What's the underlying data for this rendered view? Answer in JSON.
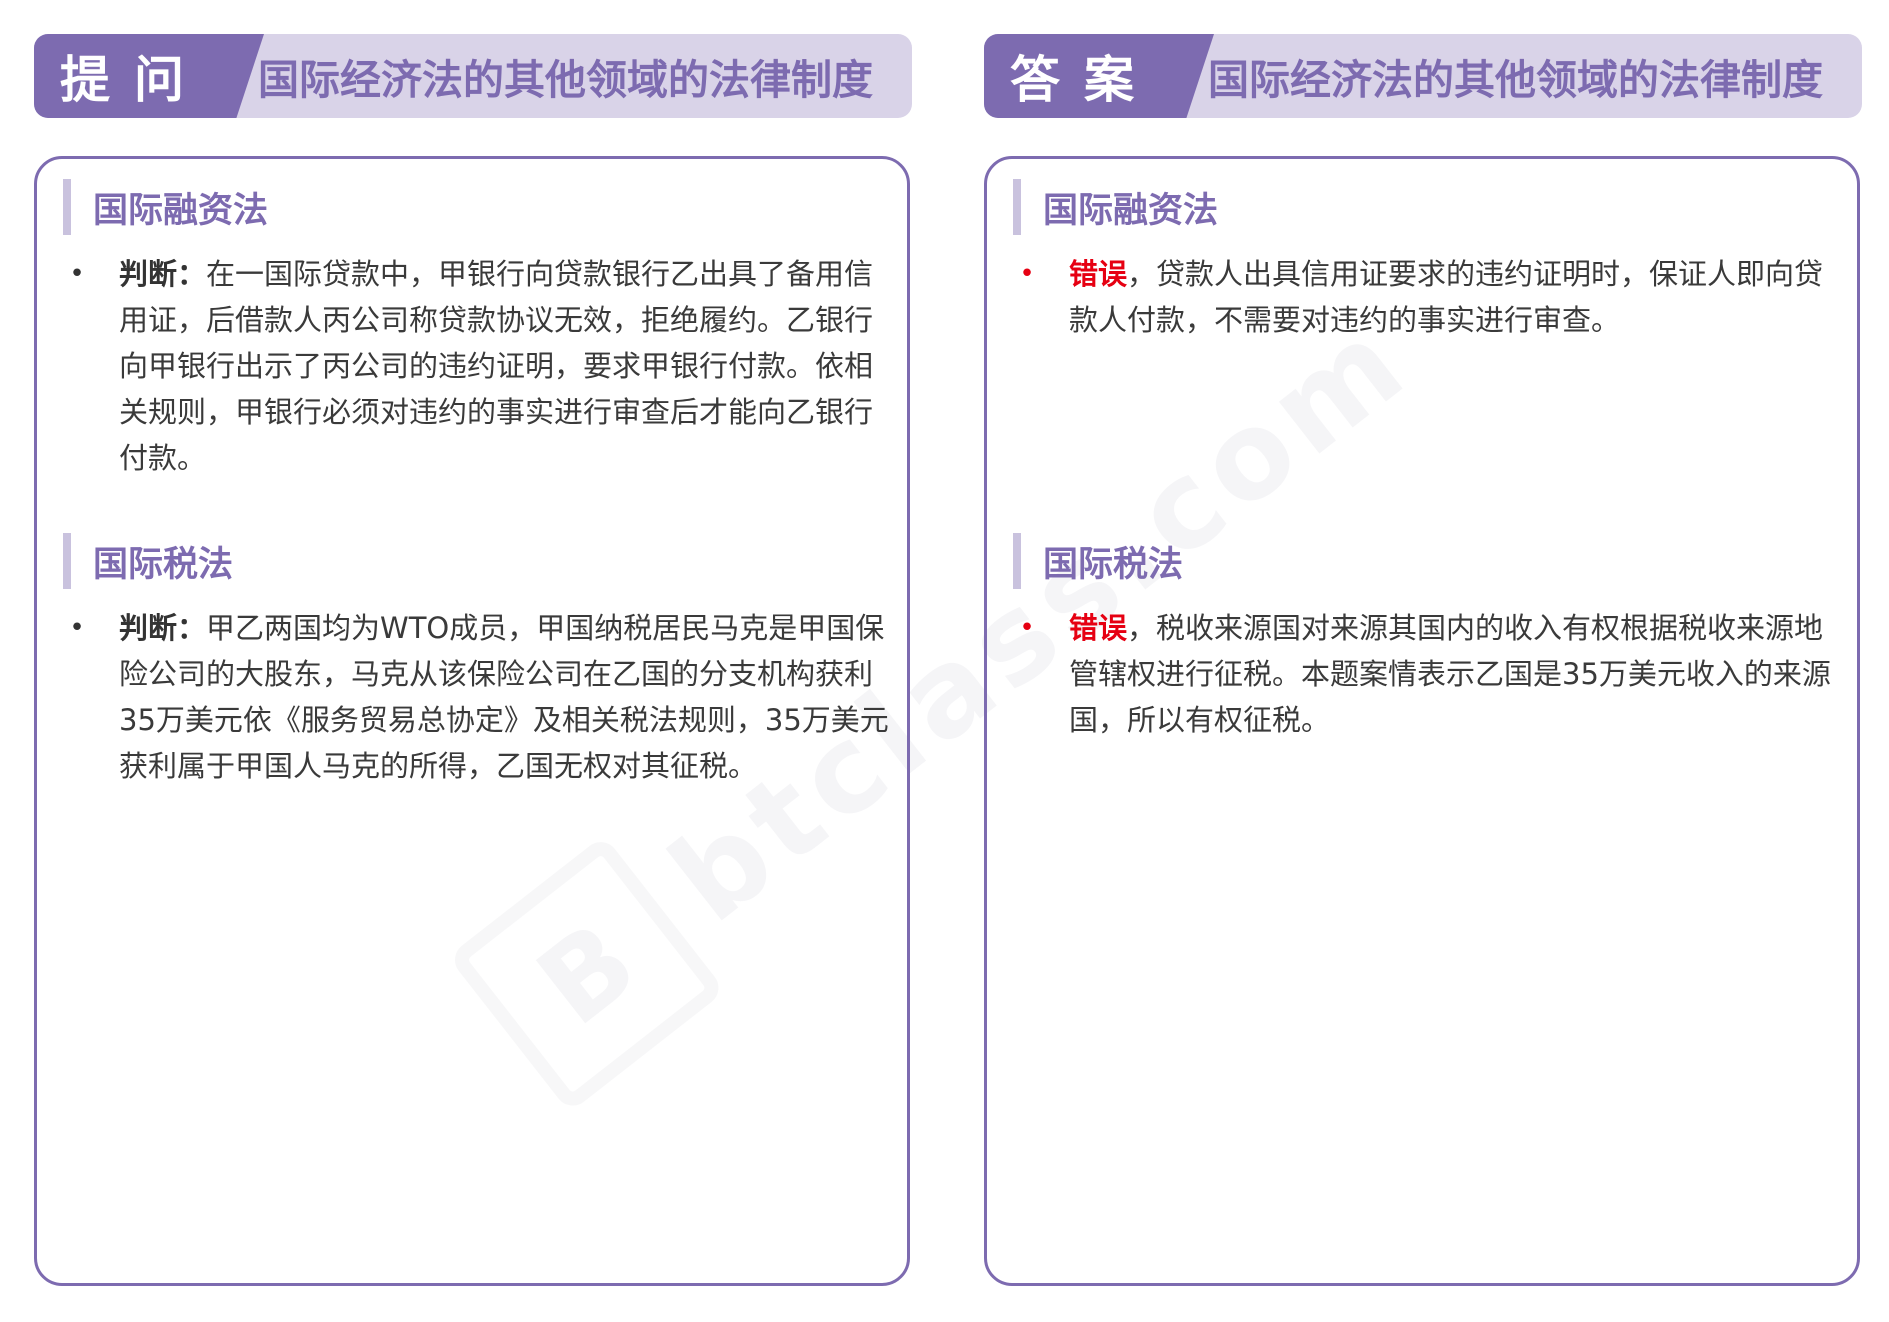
{
  "question": {
    "tag": "提问",
    "banner_title": "国际经济法的其他领域的法律制度",
    "sections": [
      {
        "title": "国际融资法",
        "lead": "判断：",
        "text": "在一国际贷款中，甲银行向贷款银行乙出具了备用信用证，后借款人丙公司称贷款协议无效，拒绝履约。乙银行向甲银行出示了丙公司的违约证明，要求甲银行付款。依相关规则，甲银行必须对违约的事实进行审查后才能向乙银行付款。"
      },
      {
        "title": "国际税法",
        "lead": "判断：",
        "text": "甲乙两国均为WTO成员，甲国纳税居民马克是甲国保险公司的大股东，马克从该保险公司在乙国的分支机构获利35万美元依《服务贸易总协定》及相关税法规则，35万美元获利属于甲国人马克的所得，乙国无权对其征税。"
      }
    ]
  },
  "answer": {
    "tag": "答案",
    "banner_title": "国际经济法的其他领域的法律制度",
    "sections": [
      {
        "title": "国际融资法",
        "lead": "错误",
        "text": "，贷款人出具信用证要求的违约证明时，保证人即向贷款人付款，不需要对违约的事实进行审查。"
      },
      {
        "title": "国际税法",
        "lead": "错误",
        "text": "，税收来源国对来源其国内的收入有权根据税收来源地管辖权进行征税。本题案情表示乙国是35万美元收入的来源国，所以有权征税。"
      }
    ]
  },
  "watermark": {
    "text": "btclass.com"
  },
  "colors": {
    "accent": "#7d6bb0",
    "banner_bg": "#d9d3e8",
    "wrong_red": "#e60012"
  }
}
